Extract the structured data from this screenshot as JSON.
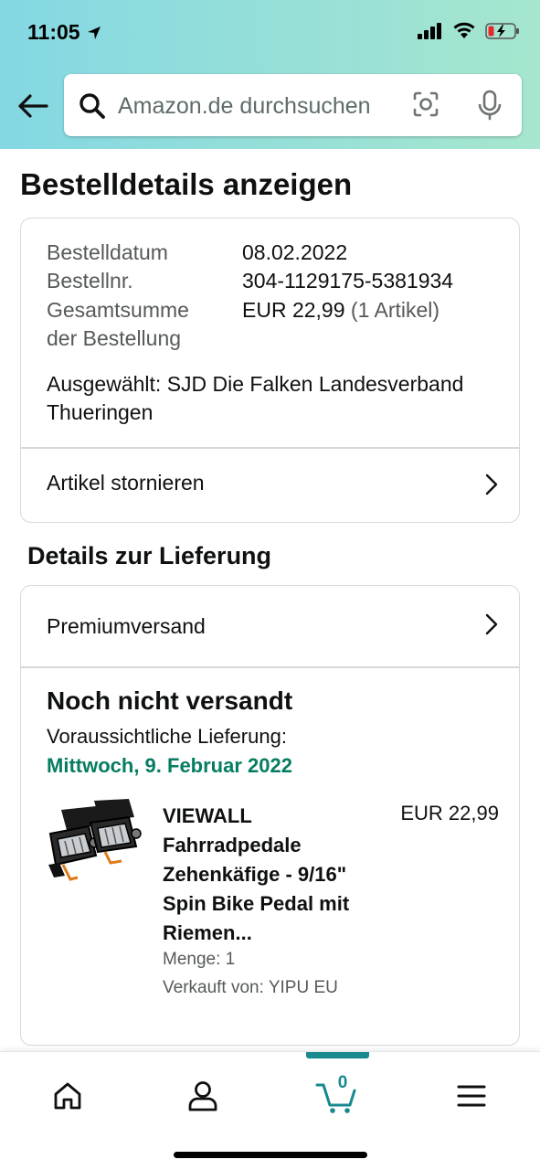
{
  "status_bar": {
    "time": "11:05"
  },
  "search": {
    "placeholder": "Amazon.de durchsuchen"
  },
  "page_title": "Bestelldetails anzeigen",
  "order": {
    "date_label": "Bestelldatum",
    "date_value": "08.02.2022",
    "number_label": "Bestellnr.",
    "number_value": "304-1129175-5381934",
    "total_label_line1": "Gesamtsumme",
    "total_label_line2": "der Bestellung",
    "total_value": "EUR 22,99",
    "total_items": "(1 Artikel)",
    "selected": "Ausgewählt: SJD Die Falken Landesverband Thueringen",
    "cancel_link": "Artikel stornieren"
  },
  "delivery": {
    "section_title": "Details zur Lieferung",
    "shipping_method": "Premiumversand",
    "status": "Noch nicht versandt",
    "eta_label": "Voraussichtliche Lieferung:",
    "eta_date": "Mittwoch, 9. Februar 2022"
  },
  "product": {
    "title": "VIEWALL Fahrradpedale Zehenkäfige - 9/16\" Spin Bike Pedal mit Riemen...",
    "price": "EUR 22,99",
    "quantity": "Menge: 1",
    "seller": "Verkauft von: YIPU EU"
  },
  "bottom_nav": {
    "cart_count": "0"
  },
  "colors": {
    "header_gradient_start": "#84d8e3",
    "header_gradient_end": "#a6e6ce",
    "delivery_green": "#067d62",
    "cart_teal": "#17898f"
  }
}
